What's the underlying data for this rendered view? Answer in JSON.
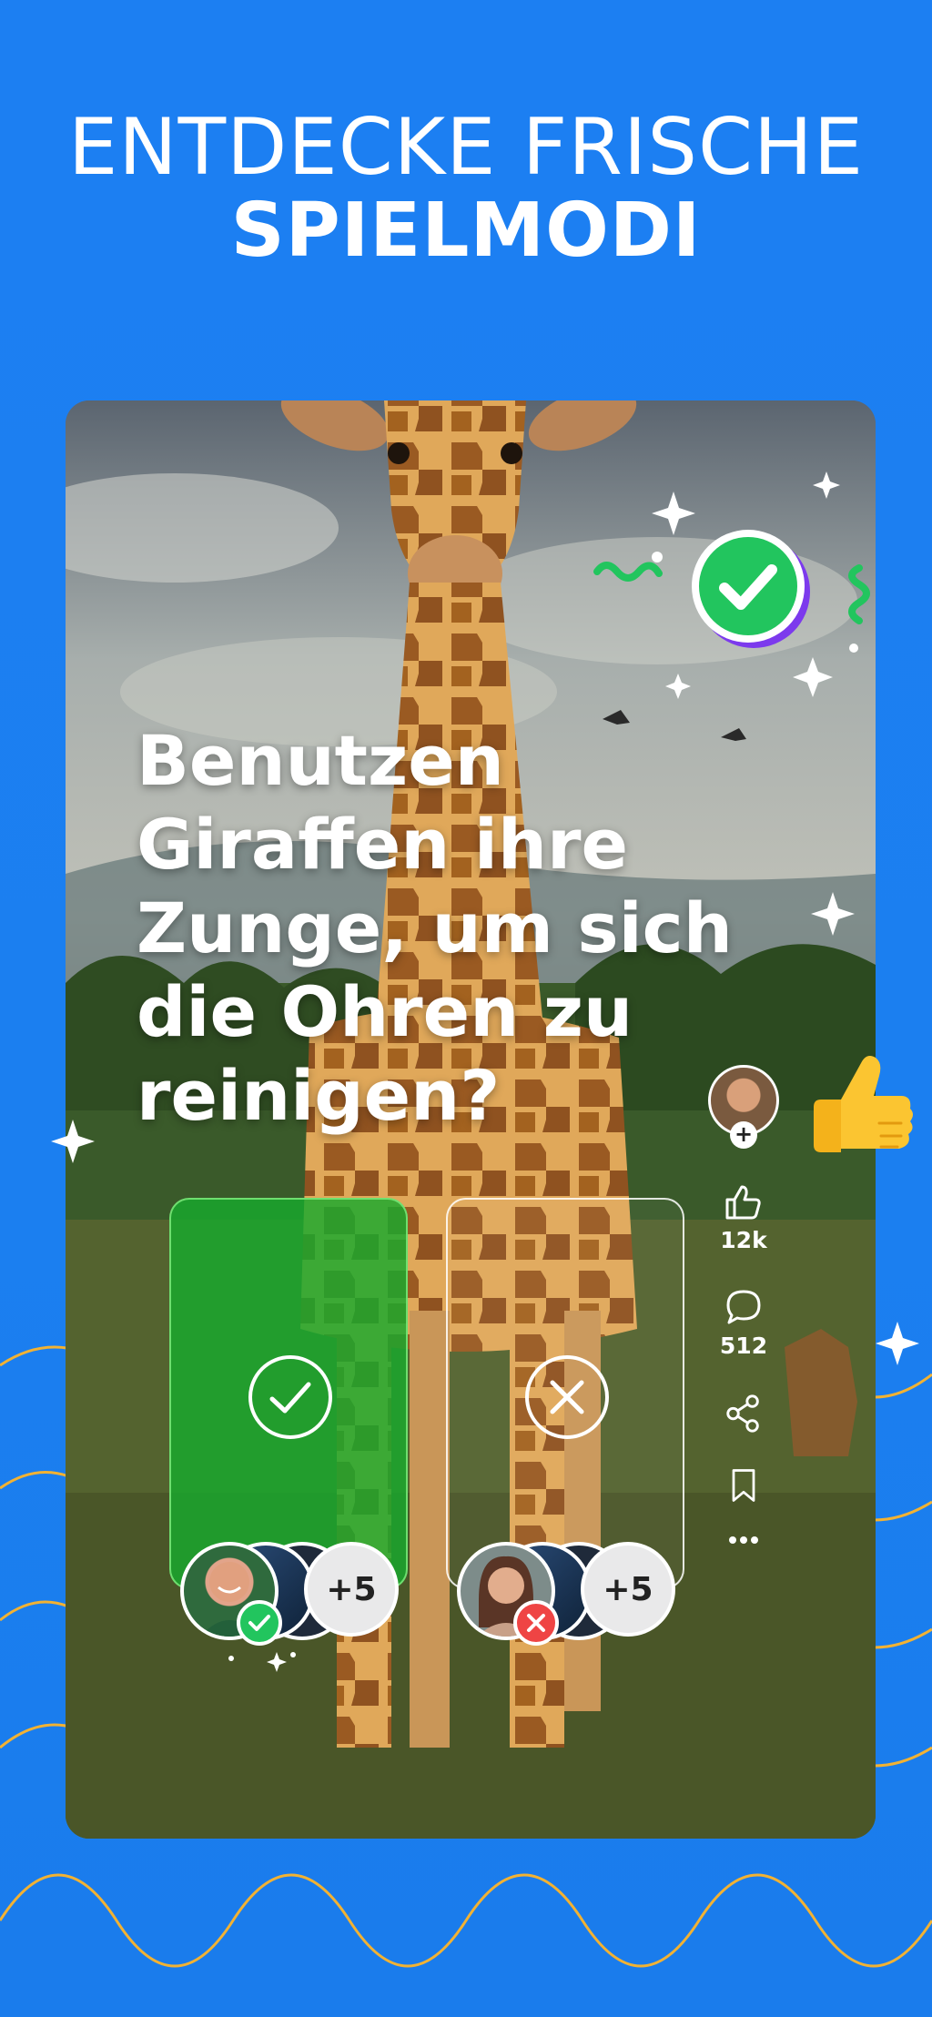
{
  "hero": {
    "line1": "ENTDECKE FRISCHE",
    "line2": "SPIELMODI"
  },
  "quiz": {
    "question": "Benutzen Giraffen ihre Zunge, um sich die Ohren zu reinigen?",
    "answers": [
      {
        "id": "yes",
        "icon": "check-circle-icon",
        "selected": true,
        "color": "#17aa2d",
        "more_label": "+5",
        "badge_icon": "check-badge-icon",
        "badge_color": "#22c55e"
      },
      {
        "id": "no",
        "icon": "x-circle-icon",
        "selected": false,
        "more_label": "+5",
        "badge_icon": "x-badge-icon",
        "badge_color": "#ef4444"
      }
    ]
  },
  "sidebar": {
    "follow_icon": "plus-icon",
    "like": {
      "icon": "thumbs-up-outline-icon",
      "count": "12k"
    },
    "comment": {
      "icon": "comment-icon",
      "count": "512"
    },
    "share": {
      "icon": "share-icon"
    },
    "bookmark": {
      "icon": "bookmark-icon"
    },
    "more": {
      "icon": "more-dots-icon"
    }
  },
  "colors": {
    "background": "#1b7ff0",
    "wave_color": "#f2b233",
    "correct_green": "#22c55e",
    "purple_shadow": "#7c3aed"
  }
}
